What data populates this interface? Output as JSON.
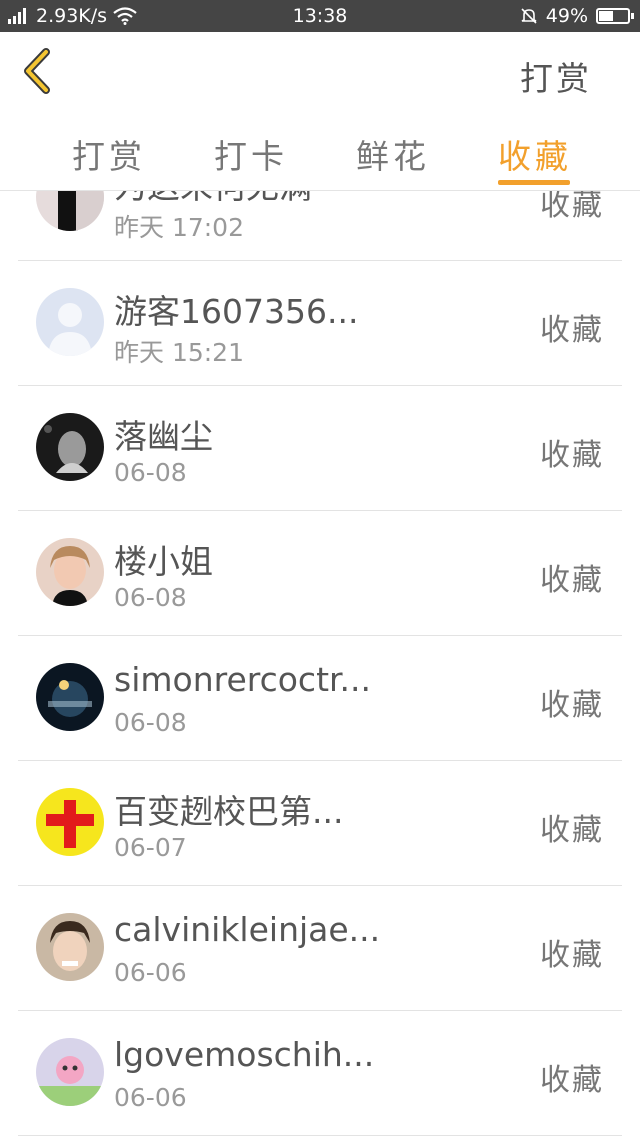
{
  "status_bar": {
    "network_type": "4G",
    "speed": "2.93K/s",
    "time": "13:38",
    "battery": "49%",
    "battery_level": 0.49
  },
  "header": {
    "right_label": "打赏"
  },
  "tabs": [
    {
      "label": "打赏",
      "active": false
    },
    {
      "label": "打卡",
      "active": false
    },
    {
      "label": "鲜花",
      "active": false
    },
    {
      "label": "收藏",
      "active": true
    }
  ],
  "accent_color": "#f2a02c",
  "list": [
    {
      "name": "为这末何无满",
      "date": "昨天 17:02",
      "action": "收藏"
    },
    {
      "name": "游客1607356...",
      "date": "昨天 15:21",
      "action": "收藏"
    },
    {
      "name": "落幽尘",
      "date": "06-08",
      "action": "收藏"
    },
    {
      "name": "楼小姐",
      "date": "06-08",
      "action": "收藏"
    },
    {
      "name": "simonrercoctr...",
      "date": "06-08",
      "action": "收藏"
    },
    {
      "name": "百变趔校巴第...",
      "date": "06-07",
      "action": "收藏"
    },
    {
      "name": "calvinikleinjae...",
      "date": "06-06",
      "action": "收藏"
    },
    {
      "name": "lgovemoschih...",
      "date": "06-06",
      "action": "收藏"
    }
  ]
}
